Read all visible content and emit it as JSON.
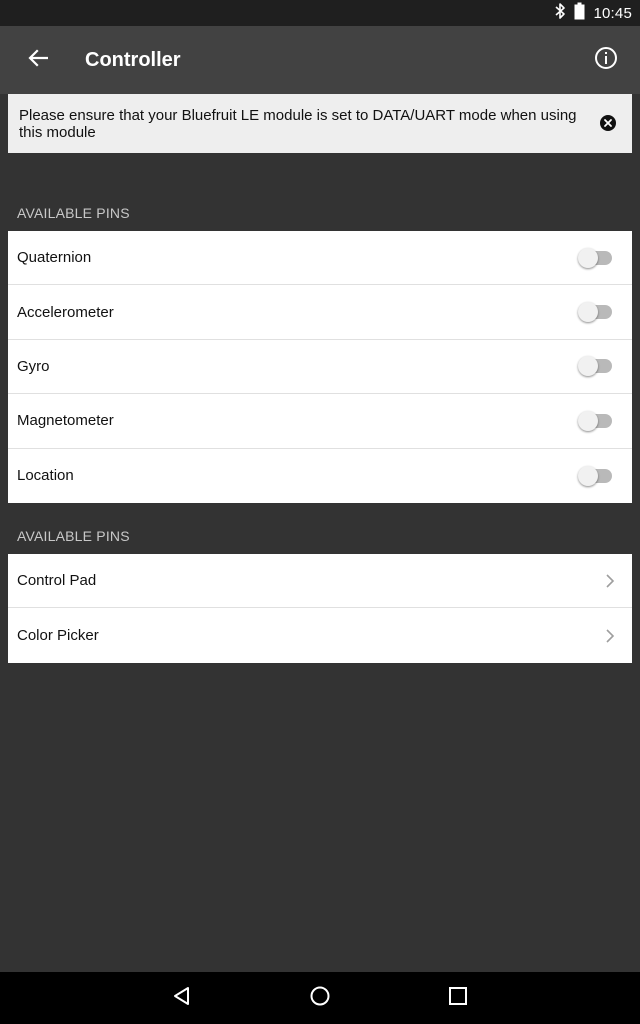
{
  "status_bar": {
    "time": "10:45"
  },
  "app_bar": {
    "title": "Controller"
  },
  "banner": {
    "message": "Please ensure that your Bluefruit LE module is set to DATA/UART mode when using this module"
  },
  "sensors_section": {
    "header": "AVAILABLE PINS",
    "items": [
      {
        "label": "Quaternion",
        "enabled": false
      },
      {
        "label": "Accelerometer",
        "enabled": false
      },
      {
        "label": "Gyro",
        "enabled": false
      },
      {
        "label": "Magnetometer",
        "enabled": false
      },
      {
        "label": "Location",
        "enabled": false
      }
    ]
  },
  "modules_section": {
    "header": "AVAILABLE PINS",
    "items": [
      {
        "label": "Control Pad"
      },
      {
        "label": "Color Picker"
      }
    ]
  },
  "colors": {
    "app_bar": "#424242",
    "background": "#333333",
    "status_bar": "#1f1f1f",
    "banner": "#eeeeee"
  }
}
